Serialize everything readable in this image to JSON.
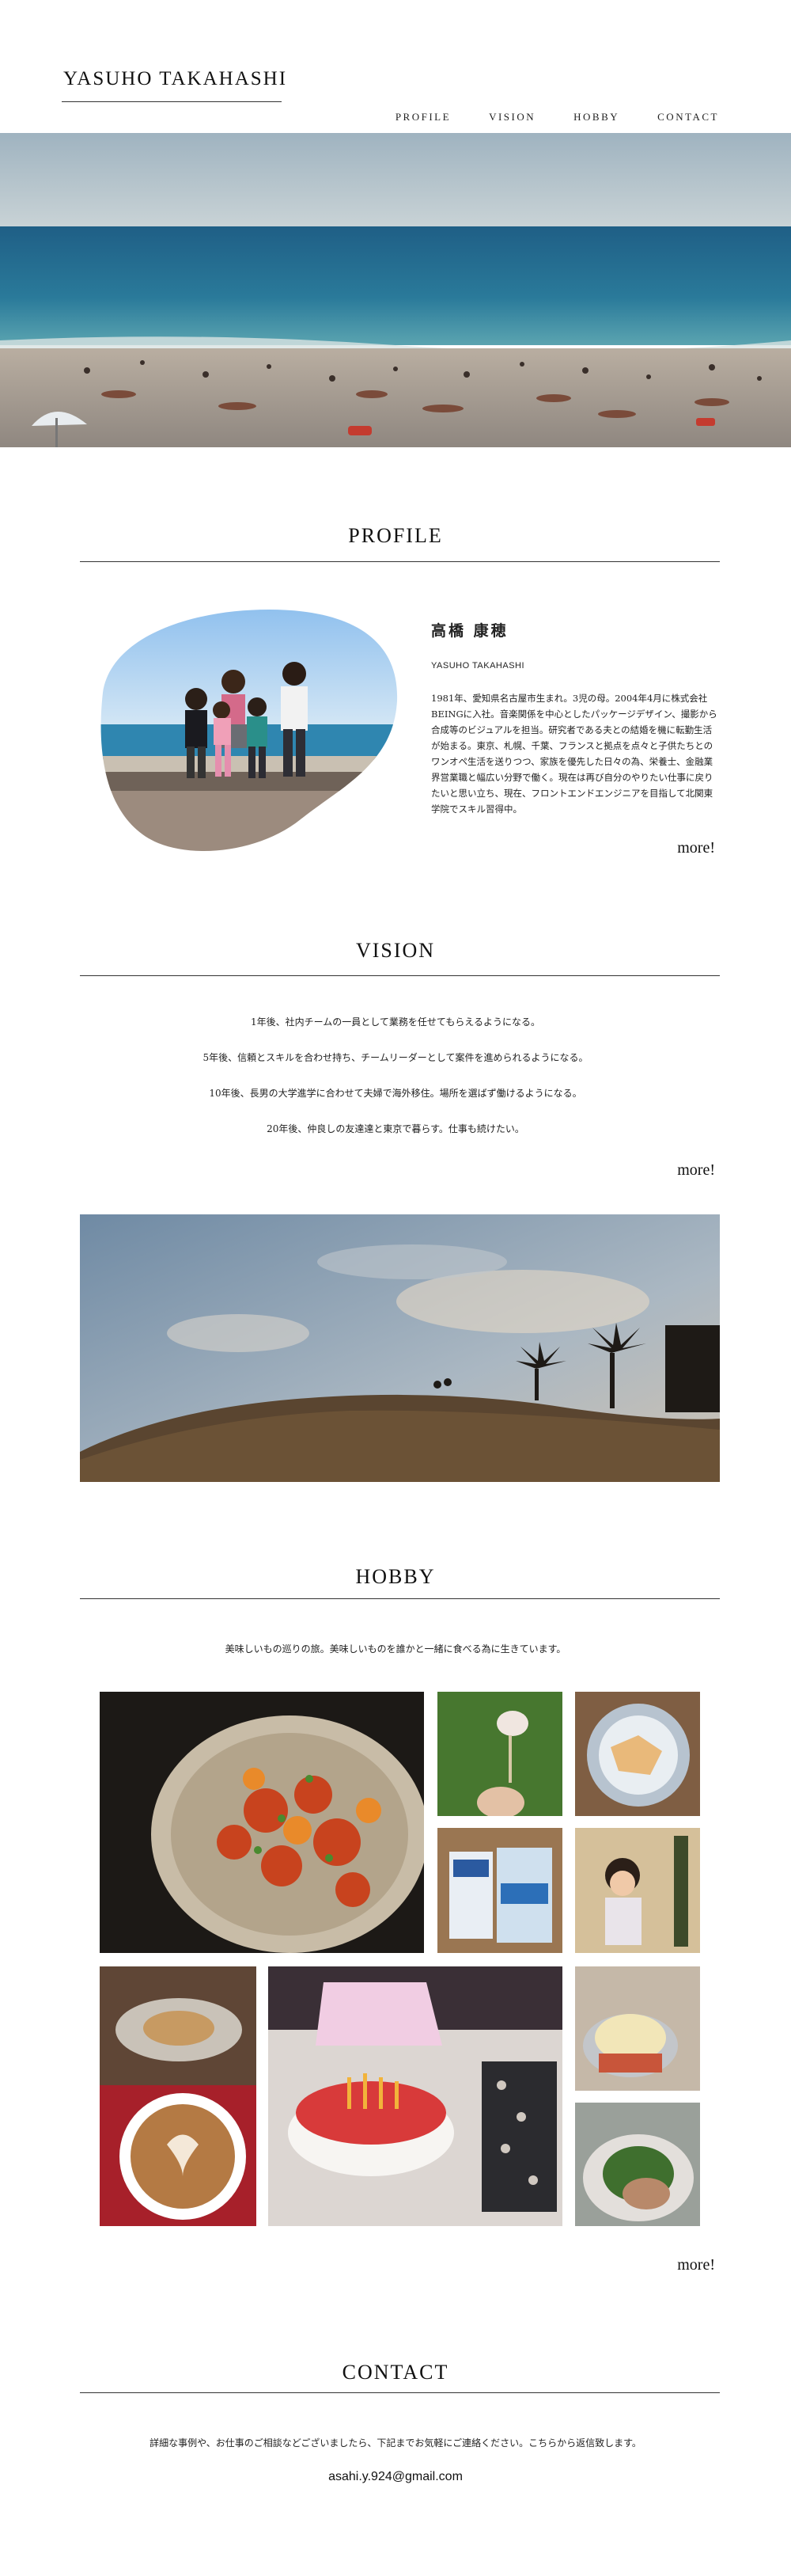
{
  "header": {
    "logo": "YASUHO TAKAHASHI",
    "nav": [
      "PROFILE",
      "VISION",
      "HOBBY",
      "CONTACT"
    ]
  },
  "profile": {
    "title": "PROFILE",
    "name_jp": "高橋 康穂",
    "name_en": "YASUHO TAKAHASHI",
    "bio": "1981年、愛知県名古屋市生まれ。3児の母。2004年4月に株式会社BEINGに入社。音楽関係を中心としたパッケージデザイン、撮影から合成等のビジュアルを担当。研究者である夫との結婚を機に転勤生活が始まる。東京、札幌、千葉、フランスと拠点を点々と子供たちとのワンオペ生活を送りつつ、家族を優先した日々の為、栄養士、金融業界営業職と幅広い分野で働く。現在は再び自分のやりたい仕事に戻りたいと思い立ち、現在、フロントエンドエンジニアを目指して北関東学院でスキル習得中。",
    "more": "more!"
  },
  "vision": {
    "title": "VISION",
    "lines": [
      "1年後、社内チームの一員として業務を任せてもらえるようになる。",
      "5年後、信頼とスキルを合わせ持ち、チームリーダーとして案件を進められるようになる。",
      "10年後、長男の大学進学に合わせて夫婦で海外移住。場所を選ばず働けるようになる。",
      "20年後、仲良しの友達達と東京で暮らす。仕事も続けたい。"
    ],
    "more": "more!"
  },
  "hobby": {
    "title": "HOBBY",
    "intro": "美味しいもの巡りの旅。美味しいものを誰かと一緒に食べる為に生きています。",
    "more": "more!"
  },
  "contact": {
    "title": "CONTACT",
    "text": "詳細な事例や、お仕事のご相談などございましたら、下記までお気軽にご連絡ください。こちらから返信致します。",
    "email": "asahi.y.924@gmail.com"
  }
}
